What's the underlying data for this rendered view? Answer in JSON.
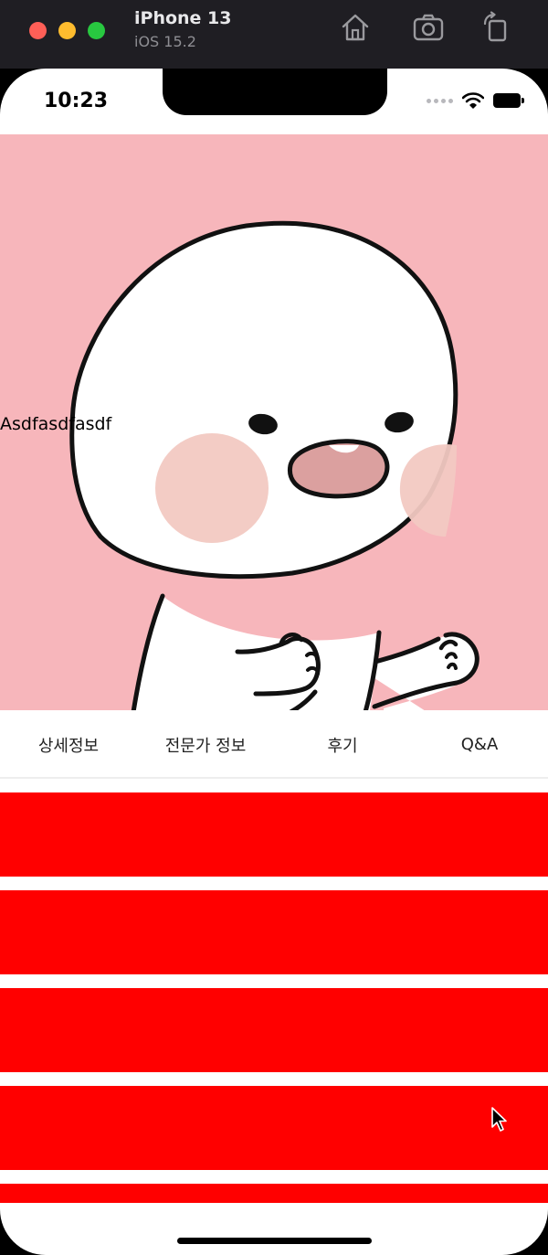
{
  "simulator": {
    "device_name": "iPhone 13",
    "os_version": "iOS 15.2",
    "toolbar_icons": [
      "home-icon",
      "screenshot-icon",
      "rotate-icon"
    ]
  },
  "status_bar": {
    "time": "10:23",
    "icons": [
      "signal-dots-icon",
      "wifi-icon",
      "battery-icon"
    ]
  },
  "hero": {
    "overlay_text": "Asdfasdfasdf",
    "background_color": "#f7b6bb"
  },
  "tabs": [
    {
      "label": "상세정보"
    },
    {
      "label": "전문가 정보"
    },
    {
      "label": "후기"
    },
    {
      "label": "Q&A"
    }
  ],
  "list": {
    "item_color": "#ff0000",
    "item_count": 5
  }
}
